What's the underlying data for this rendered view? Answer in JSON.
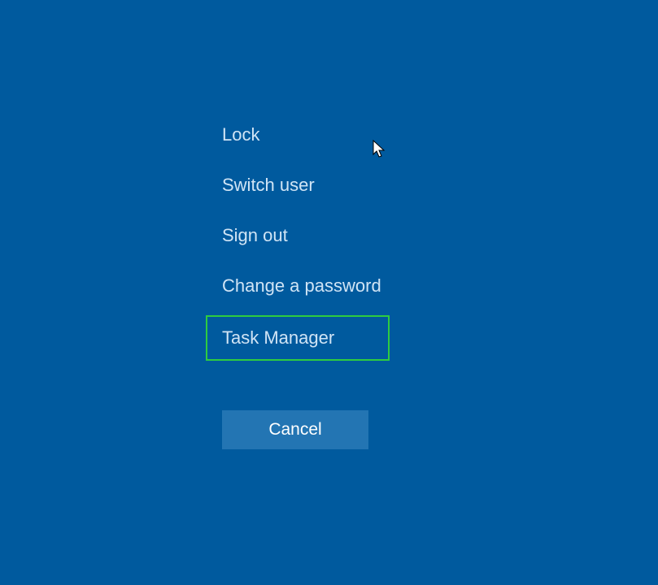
{
  "menu": {
    "items": [
      {
        "label": "Lock"
      },
      {
        "label": "Switch user"
      },
      {
        "label": "Sign out"
      },
      {
        "label": "Change a password"
      },
      {
        "label": "Task Manager"
      }
    ]
  },
  "cancel_label": "Cancel",
  "colors": {
    "background": "#005a9e",
    "text": "#d0e4f5",
    "button_bg": "#2375b3",
    "highlight_border": "#2ecc40"
  }
}
